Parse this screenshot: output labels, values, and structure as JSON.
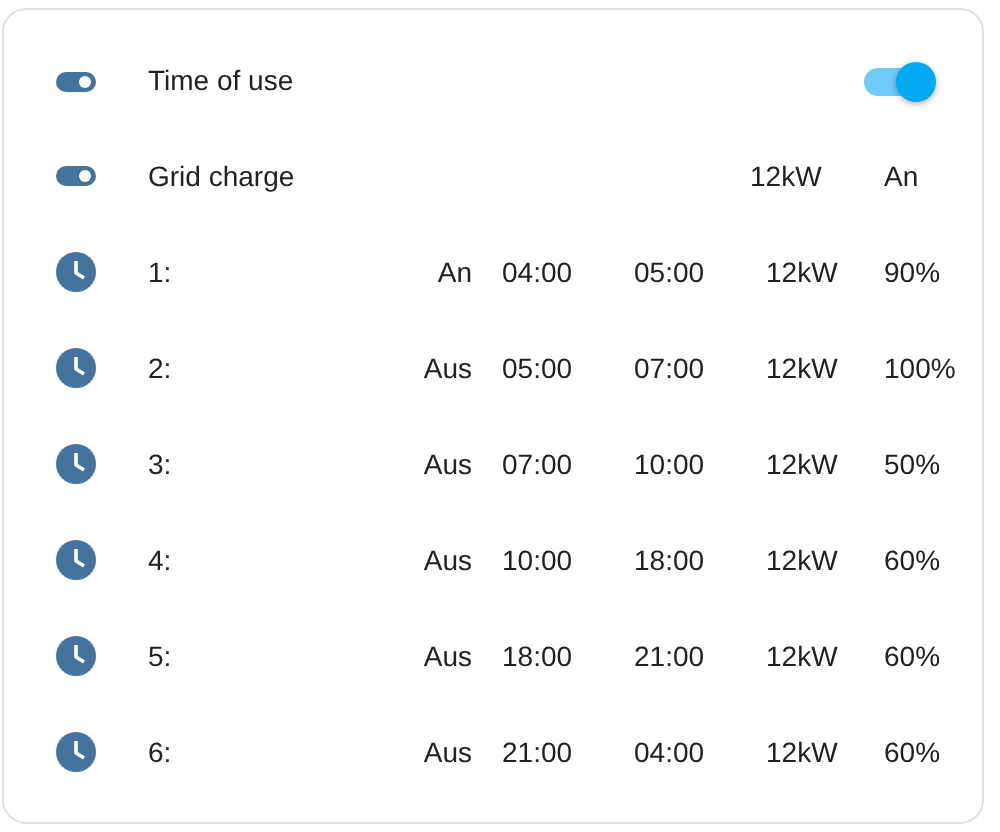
{
  "time_of_use": {
    "label": "Time of use",
    "on": true
  },
  "grid_charge": {
    "label": "Grid charge",
    "power": "12kW",
    "state": "An"
  },
  "slots": [
    {
      "label": "1:",
      "state": "An",
      "start": "04:00",
      "end": "05:00",
      "power": "12kW",
      "soc": "90%"
    },
    {
      "label": "2:",
      "state": "Aus",
      "start": "05:00",
      "end": "07:00",
      "power": "12kW",
      "soc": "100%"
    },
    {
      "label": "3:",
      "state": "Aus",
      "start": "07:00",
      "end": "10:00",
      "power": "12kW",
      "soc": "50%"
    },
    {
      "label": "4:",
      "state": "Aus",
      "start": "10:00",
      "end": "18:00",
      "power": "12kW",
      "soc": "60%"
    },
    {
      "label": "5:",
      "state": "Aus",
      "start": "18:00",
      "end": "21:00",
      "power": "12kW",
      "soc": "60%"
    },
    {
      "label": "6:",
      "state": "Aus",
      "start": "21:00",
      "end": "04:00",
      "power": "12kW",
      "soc": "60%"
    }
  ]
}
